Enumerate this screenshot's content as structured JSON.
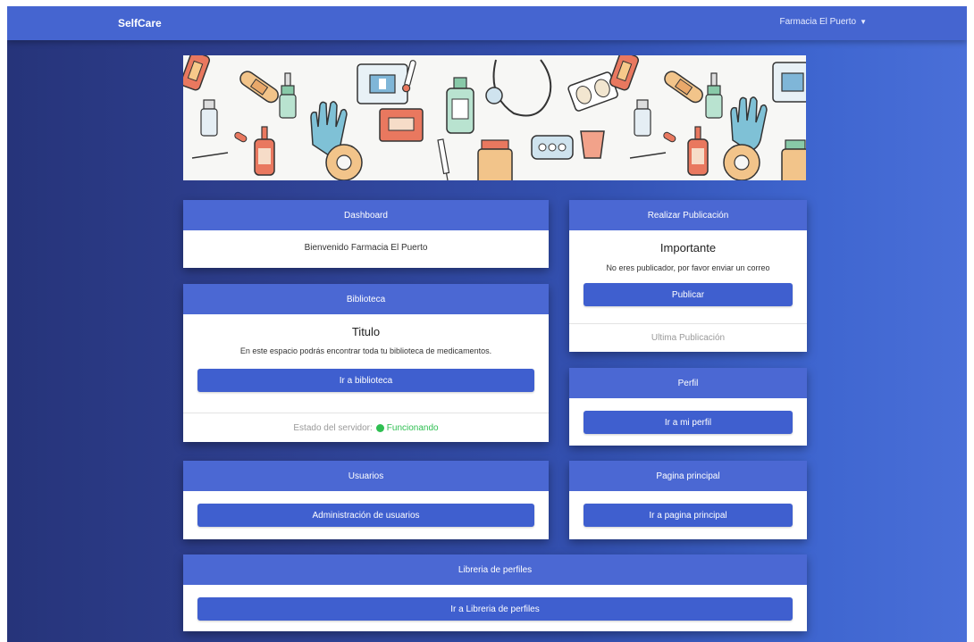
{
  "navbar": {
    "brand": "SelfCare",
    "user_menu": "Farmacia El Puerto"
  },
  "dashboard": {
    "header": "Dashboard",
    "welcome": "Bienvenido Farmacia El Puerto"
  },
  "biblioteca": {
    "header": "Biblioteca",
    "title": "Titulo",
    "text": "En este espacio podrás encontrar toda tu biblioteca de medicamentos.",
    "button": "Ir a biblioteca",
    "server_label": "Estado del servidor:",
    "server_status": "Funcionando"
  },
  "publicacion": {
    "header": "Realizar Publicación",
    "title": "Importante",
    "text": "No eres publicador, por favor enviar un correo",
    "button": "Publicar",
    "footer": "Ultima Publicación"
  },
  "perfil": {
    "header": "Perfil",
    "button": "Ir a mi perfil"
  },
  "usuarios": {
    "header": "Usuarios",
    "button": "Administración de usuarios"
  },
  "principal": {
    "header": "Pagina principal",
    "button": "Ir a pagina principal"
  },
  "libreria": {
    "header": "Libreria de perfiles",
    "button": "Ir a Libreria de perfiles"
  },
  "colors": {
    "navbar": "#4565d0",
    "card_header": "#4b68d3",
    "button": "#3f5fcf",
    "status_ok": "#2fbf52"
  },
  "banner": {
    "icons": [
      "bandage-icon",
      "medicine-bottle-icon",
      "dropper-icon",
      "glove-icon",
      "first-aid-kit-icon",
      "stethoscope-icon",
      "pill-blister-icon",
      "thermometer-icon",
      "syringe-icon",
      "measuring-cup-icon",
      "tape-roll-icon",
      "capsule-icon"
    ]
  }
}
